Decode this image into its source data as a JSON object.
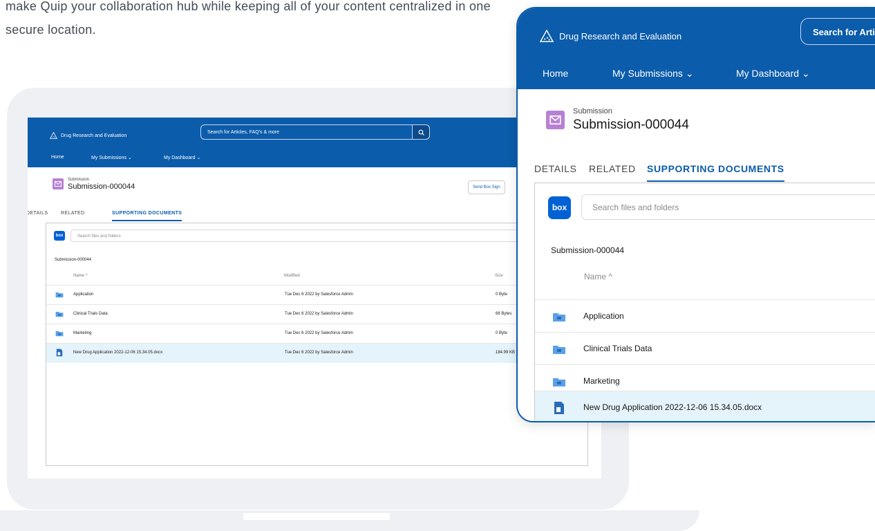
{
  "intro_text": "make Quip your collaboration hub while keeping all of your content centralized in one secure location.",
  "app": {
    "brand": "Drug Research and Evaluation",
    "search_placeholder": "Search for Articles, FAQ's & more",
    "search_placeholder_zoom": "Search for Articles",
    "nav": {
      "home": "Home",
      "my_submissions": "My Submissions",
      "my_dashboard": "My Dashboard"
    },
    "record": {
      "object_label": "Submission",
      "name": "Submission-000044"
    },
    "send_box_button": "Send Box Sign",
    "tabs": {
      "details": "DETAILS",
      "related": "RELATED",
      "supporting": "SUPPORTING DOCUMENTS"
    },
    "box": {
      "logo": "box",
      "search_placeholder": "Search files and folders",
      "folder_name": "Submission-000044",
      "columns": {
        "name": "Name",
        "modified": "Modified",
        "size": "Size"
      },
      "rows": [
        {
          "name": "Application",
          "modified": "Tue Dec 6 2022 by Salesforce Admin",
          "size": "0 Byte",
          "type": "folder"
        },
        {
          "name": "Clinical Trials Data",
          "modified": "Tue Dec 6 2022 by Salesforce Admin",
          "size": "68 Bytes",
          "type": "folder"
        },
        {
          "name": "Marketing",
          "modified": "Tue Dec 6 2022 by Salesforce Admin",
          "size": "0 Byte",
          "type": "folder"
        },
        {
          "name": "New Drug Application 2022-12-06 15.34.05.docx",
          "modified": "Tue Dec 6 2022 by Salesforce Admin",
          "size": "184.99 KB",
          "type": "docx"
        }
      ]
    }
  },
  "colors": {
    "header_blue": "#0b5cab",
    "box_blue": "#0061d5",
    "submission_purple": "#b781d3",
    "selected_row": "#e5f3fb"
  }
}
